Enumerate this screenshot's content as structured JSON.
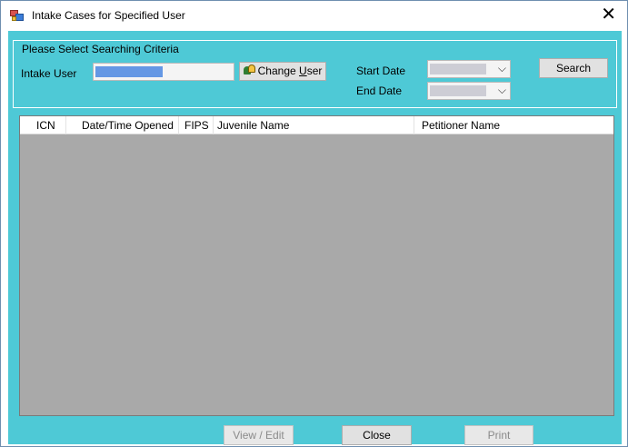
{
  "window": {
    "title": "Intake Cases for Specified User",
    "close_glyph": "✕"
  },
  "criteria": {
    "legend": "Please Select Searching Criteria",
    "intake_user_label": "Intake User",
    "change_user_label": "Change User",
    "start_date_label": "Start Date",
    "end_date_label": "End Date",
    "date_dropdown_glyph": "⌵",
    "search_label": "Search"
  },
  "grid": {
    "columns": [
      "ICN",
      "Date/Time Opened",
      "FIPS",
      "Juvenile Name",
      "Petitioner Name"
    ],
    "rows": []
  },
  "actions": {
    "view_edit_label": "View / Edit",
    "close_label": "Close",
    "print_label": "Print"
  },
  "colors": {
    "client_background": "#4ec9d6",
    "grid_background": "#a9a9a9"
  }
}
